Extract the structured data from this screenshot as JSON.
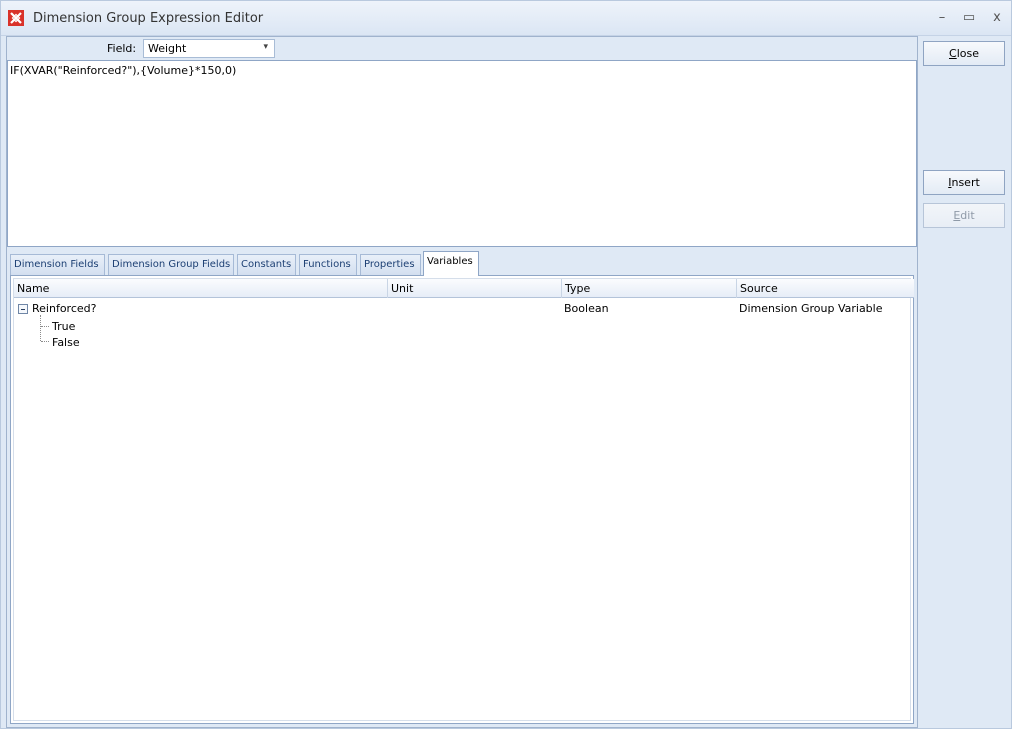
{
  "window": {
    "title": "Dimension Group Expression Editor",
    "controls": {
      "minimize": "–",
      "maximize": "▭",
      "close": "x"
    }
  },
  "field": {
    "label": "Field:",
    "value": "Weight"
  },
  "expression": "IF(XVAR(\"Reinforced?\"),{Volume}*150,0)",
  "tabs": [
    {
      "label": "Dimension Fields"
    },
    {
      "label": "Dimension Group Fields"
    },
    {
      "label": "Constants"
    },
    {
      "label": "Functions"
    },
    {
      "label": "Properties"
    },
    {
      "label": "Variables",
      "active": true
    }
  ],
  "columns": [
    "Name",
    "Unit",
    "Type",
    "Source"
  ],
  "rows": [
    {
      "name": "Reinforced?",
      "unit": "",
      "type": "Boolean",
      "source": "Dimension Group Variable",
      "expanded": true
    },
    {
      "name": "True"
    },
    {
      "name": "False"
    }
  ],
  "buttons": {
    "close": {
      "first": "C",
      "rest": "lose"
    },
    "insert": {
      "first": "I",
      "rest": "nsert"
    },
    "edit": {
      "first": "E",
      "rest": "dit",
      "disabled": true
    }
  },
  "colors": {
    "accent_icon": "#d9322a",
    "chrome": "#dfe9f5",
    "tab_text": "#1c3f73"
  }
}
